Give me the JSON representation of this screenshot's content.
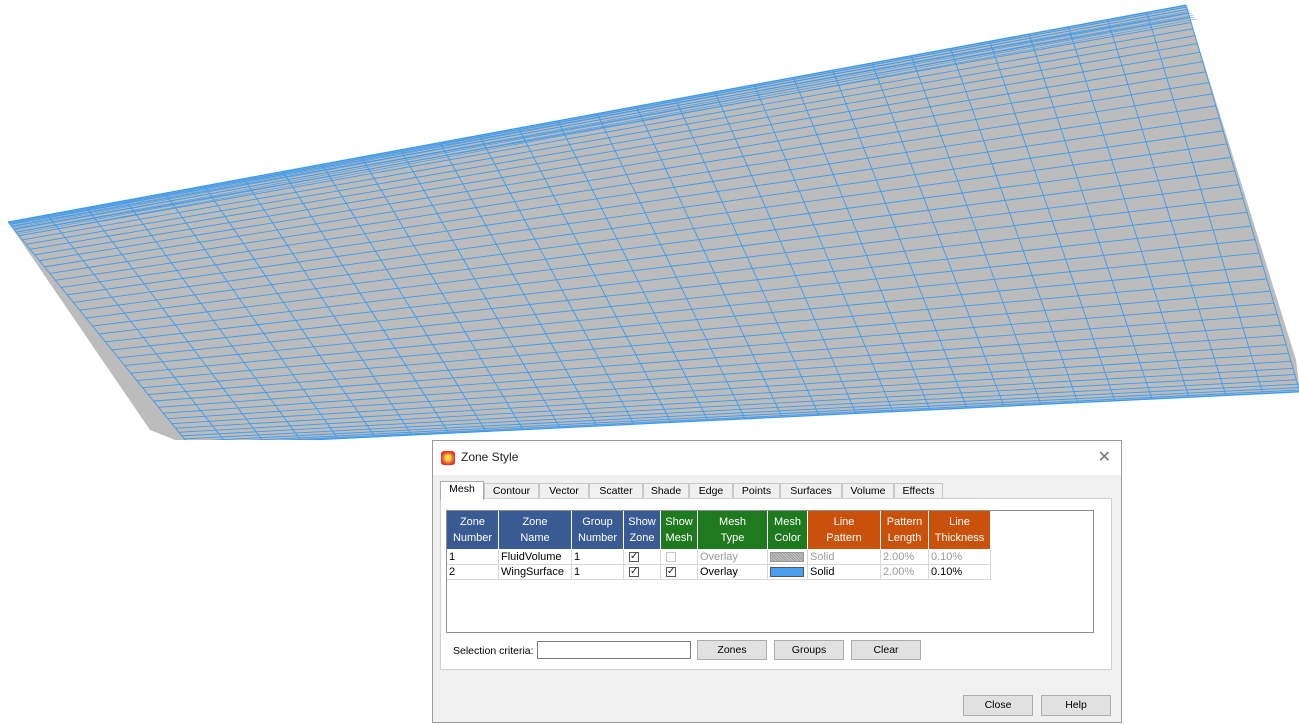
{
  "mesh_colors": {
    "surface": "#bcbcbc",
    "grid": "#3d9bef"
  },
  "dialog": {
    "title": "Zone Style",
    "tabs": [
      "Mesh",
      "Contour",
      "Vector",
      "Scatter",
      "Shade",
      "Edge",
      "Points",
      "Surfaces",
      "Volume",
      "Effects"
    ],
    "active_tab": "Mesh",
    "columns": [
      {
        "line1": "Zone",
        "line2": "Number",
        "group": "blue"
      },
      {
        "line1": "Zone",
        "line2": "Name",
        "group": "blue"
      },
      {
        "line1": "Group",
        "line2": "Number",
        "group": "blue"
      },
      {
        "line1": "Show",
        "line2": "Zone",
        "group": "blue"
      },
      {
        "line1": "Show",
        "line2": "Mesh",
        "group": "green"
      },
      {
        "line1": "Mesh",
        "line2": "Type",
        "group": "green"
      },
      {
        "line1": "Mesh",
        "line2": "Color",
        "group": "green"
      },
      {
        "line1": "Line",
        "line2": "Pattern",
        "group": "orange"
      },
      {
        "line1": "Pattern",
        "line2": "Length",
        "group": "orange"
      },
      {
        "line1": "Line",
        "line2": "Thickness",
        "group": "orange"
      }
    ],
    "rows": [
      {
        "zone_number": "1",
        "zone_name": "FluidVolume",
        "group_number": "1",
        "show_zone": true,
        "show_mesh": false,
        "mesh_type": "Overlay",
        "mesh_color": "#8c8c8c",
        "line_pattern": "Solid",
        "pattern_length": "2.00%",
        "line_thickness": "0.10%"
      },
      {
        "zone_number": "2",
        "zone_name": "WingSurface",
        "group_number": "1",
        "show_zone": true,
        "show_mesh": true,
        "mesh_type": "Overlay",
        "mesh_color": "#3d9bef",
        "line_pattern": "Solid",
        "pattern_length": "2.00%",
        "line_thickness": "0.10%"
      }
    ],
    "selection_criteria_label": "Selection criteria:",
    "selection_criteria_value": "",
    "zones_button": "Zones",
    "groups_button": "Groups",
    "clear_button": "Clear",
    "close_button": "Close",
    "help_button": "Help"
  }
}
